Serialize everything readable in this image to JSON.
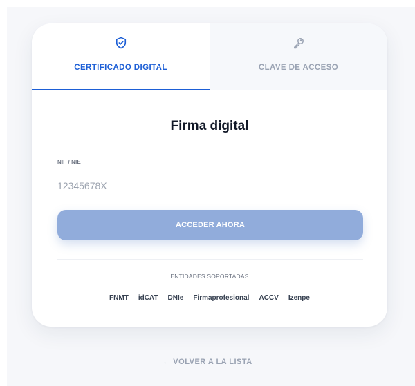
{
  "tabs": [
    {
      "label": "CERTIFICADO DIGITAL",
      "icon": "shield-check-icon",
      "active": true
    },
    {
      "label": "CLAVE DE ACCESO",
      "icon": "key-icon",
      "active": false
    }
  ],
  "form": {
    "title": "Firma digital",
    "nif_label": "NIF / NIE",
    "nif_placeholder": "12345678X",
    "nif_value": "",
    "submit_label": "ACCEDER AHORA"
  },
  "entities": {
    "title": "ENTIDADES SOPORTADAS",
    "items": [
      "FNMT",
      "idCAT",
      "DNIe",
      "Firmaprofesional",
      "ACCV",
      "Izenpe"
    ]
  },
  "back_link": "← VOLVER A LA LISTA",
  "colors": {
    "accent": "#1d5fd6",
    "button": "#91acdb",
    "muted": "#9aa3b3",
    "background": "#f6f7fa"
  }
}
